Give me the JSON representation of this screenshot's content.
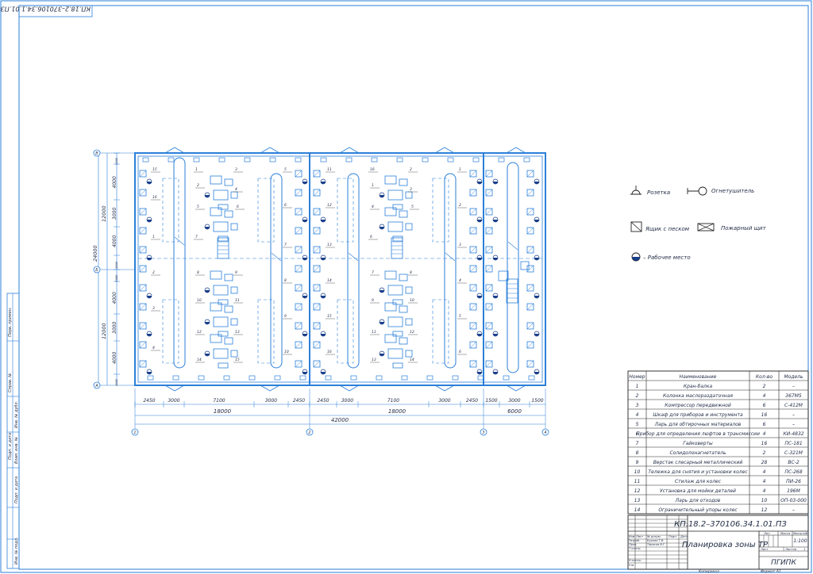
{
  "stamp_code_rotated": "КП.18.2–370106.34.1.01.ПЗ",
  "dimensions": {
    "bottom_row": [
      "2450",
      "3000",
      "7100",
      "3000",
      "2450",
      "2450",
      "3000",
      "7100",
      "3000",
      "2450",
      "1500",
      "3000",
      "1500"
    ],
    "spans": [
      "18000",
      "18000",
      "6000"
    ],
    "total": "42000",
    "left_segments": [
      "1000",
      "4000",
      "3000",
      "4000",
      "1000",
      "1000",
      "4000",
      "3000",
      "4000",
      "1000"
    ],
    "left_halves": [
      "12000",
      "12000"
    ],
    "left_total": "24000"
  },
  "axes": {
    "rows": [
      "В",
      "Б",
      "А"
    ],
    "cols": [
      "1",
      "2",
      "3",
      "4"
    ]
  },
  "equipment_numbers": [
    "1",
    "2",
    "3",
    "4",
    "5",
    "6",
    "7",
    "8",
    "9",
    "10",
    "11",
    "12",
    "13",
    "14",
    "15",
    "16"
  ],
  "legend": [
    {
      "icon": "socket-icon",
      "label": "Розетка"
    },
    {
      "icon": "fire-extinguisher-icon",
      "label": "Огнетушитель"
    },
    {
      "icon": "sand-box-icon",
      "label": "Ящик с песком"
    },
    {
      "icon": "fire-panel-icon",
      "label": "Пожарный щит"
    },
    {
      "icon": "workplace-icon",
      "label": "– Рабочее место"
    }
  ],
  "spec_table": {
    "headers": [
      "Номер",
      "Наименование",
      "Кол-во",
      "Модель"
    ],
    "rows": [
      [
        "1",
        "Кран-балка",
        "2",
        "–"
      ],
      [
        "2",
        "Колонка маслораздаточная",
        "4",
        "367М5"
      ],
      [
        "3",
        "Компрессор передвижной",
        "6",
        "С-412М"
      ],
      [
        "4",
        "Шкаф для приборов и инструмента",
        "16",
        "–"
      ],
      [
        "5",
        "Ларь для обтирочных материалов",
        "6",
        "–"
      ],
      [
        "6",
        "Прибор для определения люфтов в трансмиссии",
        "4",
        "КИ-4832"
      ],
      [
        "7",
        "Гайковерты",
        "16",
        "ПС-181"
      ],
      [
        "8",
        "Солидолонагнетатель",
        "2",
        "С-321М"
      ],
      [
        "9",
        "Верстак слесарный металлический",
        "28",
        "ВС-2"
      ],
      [
        "10",
        "Тележка для снятия и установки колес",
        "4",
        "ПС-268"
      ],
      [
        "11",
        "Стилаж для колес",
        "4",
        "ПИ-26"
      ],
      [
        "12",
        "Установка для мойки деталей",
        "4",
        "196М"
      ],
      [
        "13",
        "Ларь для отходов",
        "10",
        "ОП-03-000"
      ],
      [
        "14",
        "Ограничительный упоры колес",
        "12",
        "–"
      ]
    ]
  },
  "title_block": {
    "code": "КП.18.2–370106.34.1.01.ПЗ",
    "title": "Планировка зоны ТР",
    "org": "ПГИПК",
    "stage_header": "Лит.",
    "mass_header": "Масса",
    "scale_header": "Масштаб",
    "scale": "1:100",
    "sheet_label": "Лист",
    "sheets_label": "Листов",
    "sheets_value": "1",
    "rows_left": [
      "Изм.",
      "Лист",
      "№ докум.",
      "Подп.",
      "Дата"
    ],
    "roles": [
      "Разраб.",
      "Пров.",
      "Т.контр.",
      "",
      "Н.контр.",
      "Утв."
    ],
    "names": [
      "Бурова Т.В.",
      "Тарасов В.Г."
    ],
    "copied": "Копировал",
    "format": "Формат   А1"
  },
  "side_strip": [
    "Перв. примен.",
    "Справ. №",
    "Подп. и дата",
    "Инв. № дубл.",
    "Взам. инв. №",
    "Подп. и дата",
    "Инв. № подл."
  ]
}
